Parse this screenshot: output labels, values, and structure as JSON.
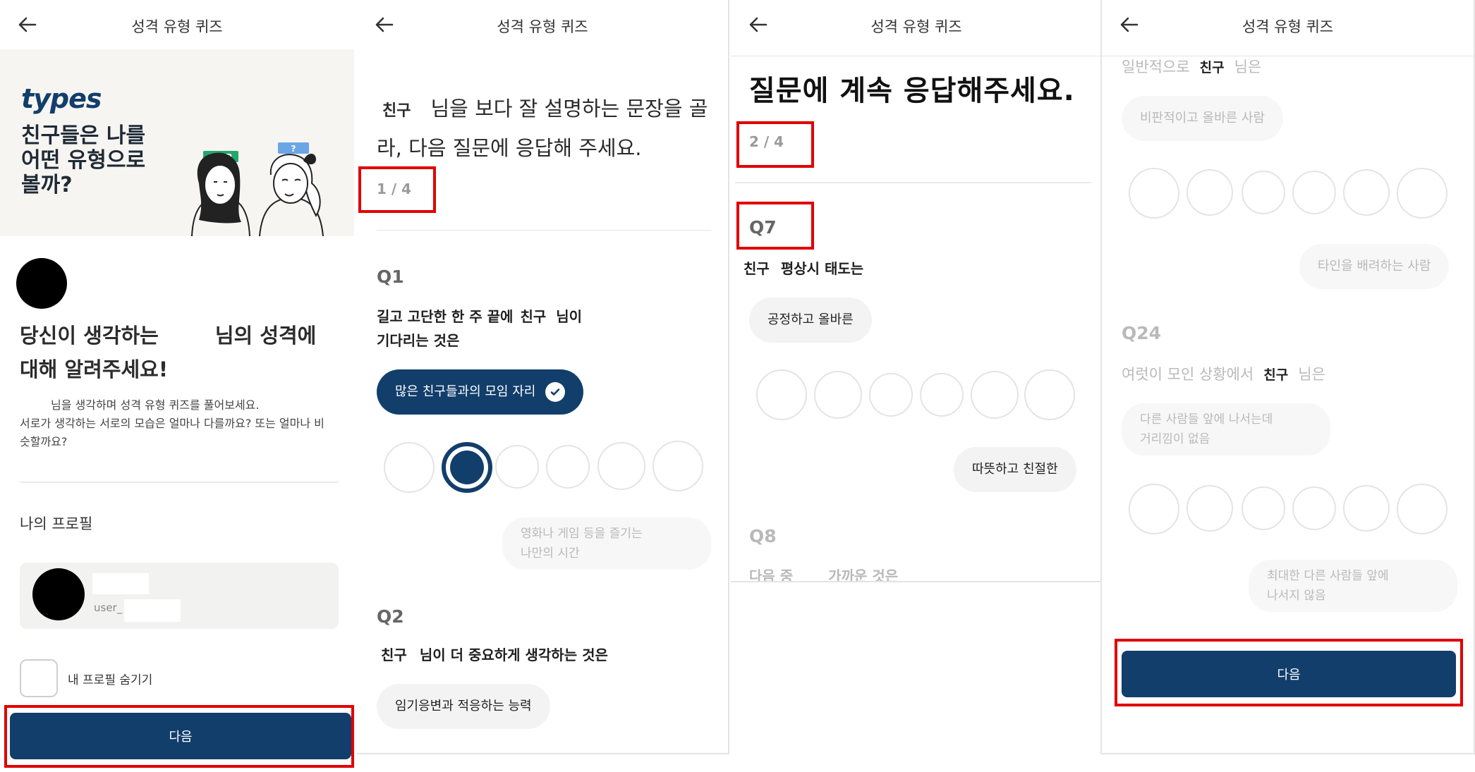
{
  "header": {
    "title": "성격 유형 퀴즈"
  },
  "screen1": {
    "logo": "types",
    "banner_headline": "친구들은 나를\n어떤 유형으로\n볼까?",
    "badge_infp": "INFP",
    "badge_unknown": "?",
    "heading_part1": "당신이 생각하는",
    "heading_part2": "님의 성격에",
    "heading_part3": "대해 알려주세요!",
    "desc_line1": "님을 생각하며 성격 유형 퀴즈를 풀어보세요.",
    "desc_line2": "서로가 생각하는 서로의 모습은 얼마나 다를까요? 또는 얼마나 비슷할까요?",
    "profile_label": "나의 프로필",
    "username_prefix": "user_",
    "hide_profile_label": "내 프로필 숨기기",
    "next_button": "다음"
  },
  "screen2": {
    "friend_tag": "친구",
    "lead_question": "님을 보다 잘 설명하는 문장을 골라, 다음 질문에 응답해 주세요.",
    "progress": "1 / 4",
    "q1": {
      "label": "Q1",
      "text_part1": "길고 고단한 한 주 끝에",
      "friend_tag": "친구",
      "text_part2": "님이",
      "text_line2": "기다리는 것은",
      "option_a": "많은 친구들과의 모임 자리",
      "option_b_line1": "영화나 게임 등을 즐기는",
      "option_b_line2": "나만의 시간",
      "selected_scale_index": 1
    },
    "q2": {
      "label": "Q2",
      "friend_tag": "친구",
      "text": "님이 더 중요하게 생각하는 것은",
      "option_a": "임기응변과 적응하는 능력"
    }
  },
  "screen3": {
    "heading": "질문에 계속 응답해주세요.",
    "progress": "2 / 4",
    "q7": {
      "label": "Q7",
      "friend_tag": "친구",
      "text": "평상시 태도는",
      "option_a": "공정하고 올바른",
      "option_b": "따뜻하고 친절한"
    },
    "q8": {
      "label": "Q8",
      "text_part1": "다음 중",
      "text_part2": "가까운 것은"
    }
  },
  "screen4": {
    "q23_text_part1": "일반적으로",
    "friend_tag": "친구",
    "q23_text_part2": "님은",
    "q23_option_a": "비판적이고 올바른 사람",
    "q23_option_b": "타인을 배려하는 사람",
    "q24": {
      "label": "Q24",
      "text_part1": "여럿이 모인 상황에서",
      "friend_tag": "친구",
      "text_part2": "님은",
      "option_a_line1": "다른 사람들 앞에 나서는데",
      "option_a_line2": "거리낌이 없음",
      "option_b_line1": "최대한 다른 사람들 앞에",
      "option_b_line2": "나서지 않음"
    },
    "next_button": "다음"
  },
  "colors": {
    "brand_navy": "#123e6b",
    "highlight_red": "#e00000",
    "pill_bg": "#f3f3f3",
    "infp_badge": "#23a86b",
    "unknown_badge": "#6aa6e6"
  }
}
